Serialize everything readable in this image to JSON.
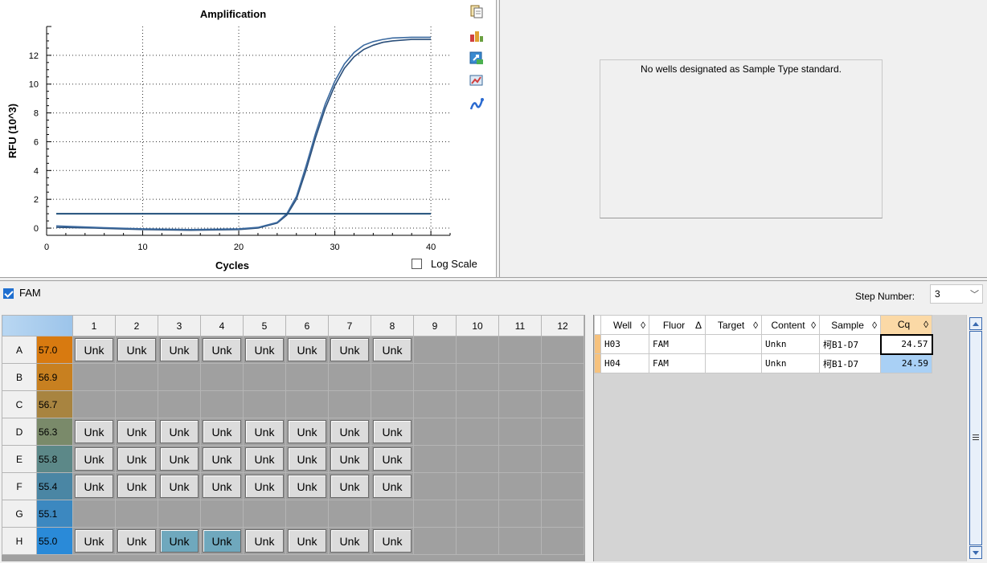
{
  "chart": {
    "title": "Amplification",
    "ylabel": "RFU (10^3)",
    "xlabel": "Cycles",
    "log_scale_label": "Log Scale"
  },
  "chart_data": {
    "type": "line",
    "title": "Amplification",
    "xlabel": "Cycles",
    "ylabel": "RFU (10^3)",
    "xlim": [
      0,
      42
    ],
    "ylim": [
      -0.5,
      14
    ],
    "xticks": [
      0,
      10,
      20,
      30,
      40
    ],
    "yticks": [
      0,
      2,
      4,
      6,
      8,
      10,
      12
    ],
    "grid": true,
    "series": [
      {
        "x": [
          1,
          5,
          10,
          15,
          20,
          22,
          24,
          25,
          26,
          27,
          28,
          29,
          30,
          31,
          32,
          33,
          34,
          35,
          36,
          38,
          40
        ],
        "y": [
          0.05,
          0.0,
          -0.1,
          -0.15,
          -0.1,
          0.0,
          0.35,
          0.9,
          2.0,
          4.0,
          6.3,
          8.3,
          9.9,
          11.1,
          11.9,
          12.4,
          12.7,
          12.9,
          13.0,
          13.1,
          13.1
        ]
      },
      {
        "x": [
          1,
          5,
          10,
          15,
          20,
          22,
          24,
          25,
          26,
          27,
          28,
          29,
          30,
          31,
          32,
          33,
          34,
          35,
          36,
          38,
          40
        ],
        "y": [
          0.15,
          0.05,
          -0.05,
          -0.1,
          -0.05,
          0.05,
          0.4,
          1.0,
          2.2,
          4.3,
          6.6,
          8.6,
          10.2,
          11.4,
          12.2,
          12.7,
          12.95,
          13.1,
          13.2,
          13.25,
          13.25
        ]
      },
      {
        "x": [
          1,
          40
        ],
        "y": [
          1.0,
          1.0
        ]
      }
    ]
  },
  "standard_curve": {
    "message": "No wells designated as Sample Type standard."
  },
  "fluor": {
    "label": "FAM",
    "checked": true
  },
  "step": {
    "label": "Step Number:",
    "value": "3"
  },
  "plate": {
    "columns": [
      "1",
      "2",
      "3",
      "4",
      "5",
      "6",
      "7",
      "8",
      "9",
      "10",
      "11",
      "12"
    ],
    "rows": [
      {
        "label": "A",
        "temp": "57.0",
        "color": "#d87a10",
        "wells": [
          "Unk",
          "Unk",
          "Unk",
          "Unk",
          "Unk",
          "Unk",
          "Unk",
          "Unk",
          "",
          "",
          "",
          ""
        ]
      },
      {
        "label": "B",
        "temp": "56.9",
        "color": "#c88020",
        "wells": [
          "",
          "",
          "",
          "",
          "",
          "",
          "",
          "",
          "",
          "",
          "",
          ""
        ]
      },
      {
        "label": "C",
        "temp": "56.7",
        "color": "#a88440",
        "wells": [
          "",
          "",
          "",
          "",
          "",
          "",
          "",
          "",
          "",
          "",
          "",
          ""
        ]
      },
      {
        "label": "D",
        "temp": "56.3",
        "color": "#7a8a6a",
        "wells": [
          "Unk",
          "Unk",
          "Unk",
          "Unk",
          "Unk",
          "Unk",
          "Unk",
          "Unk",
          "",
          "",
          "",
          ""
        ]
      },
      {
        "label": "E",
        "temp": "55.8",
        "color": "#5c8888",
        "wells": [
          "Unk",
          "Unk",
          "Unk",
          "Unk",
          "Unk",
          "Unk",
          "Unk",
          "Unk",
          "",
          "",
          "",
          ""
        ]
      },
      {
        "label": "F",
        "temp": "55.4",
        "color": "#4a86a4",
        "wells": [
          "Unk",
          "Unk",
          "Unk",
          "Unk",
          "Unk",
          "Unk",
          "Unk",
          "Unk",
          "",
          "",
          "",
          ""
        ]
      },
      {
        "label": "G",
        "temp": "55.1",
        "color": "#3c88c0",
        "wells": [
          "",
          "",
          "",
          "",
          "",
          "",
          "",
          "",
          "",
          "",
          "",
          ""
        ]
      },
      {
        "label": "H",
        "temp": "55.0",
        "color": "#2a8ad8",
        "wells": [
          "Unk",
          "Unk",
          "Unk",
          "Unk",
          "Unk",
          "Unk",
          "Unk",
          "Unk",
          "",
          "",
          "",
          ""
        ],
        "highlighted": [
          2,
          3
        ]
      }
    ]
  },
  "results": {
    "headers": [
      "Well",
      "Fluor",
      "Target",
      "Content",
      "Sample",
      "Cq"
    ],
    "header_icons": [
      "◊",
      "Δ",
      "◊",
      "◊",
      "◊",
      "◊"
    ],
    "rows": [
      {
        "well": "H03",
        "fluor": "FAM",
        "target": "",
        "content": "Unkn",
        "sample": "柯B1-D7",
        "cq": "24.57"
      },
      {
        "well": "H04",
        "fluor": "FAM",
        "target": "",
        "content": "Unkn",
        "sample": "柯B1-D7",
        "cq": "24.59"
      }
    ]
  }
}
